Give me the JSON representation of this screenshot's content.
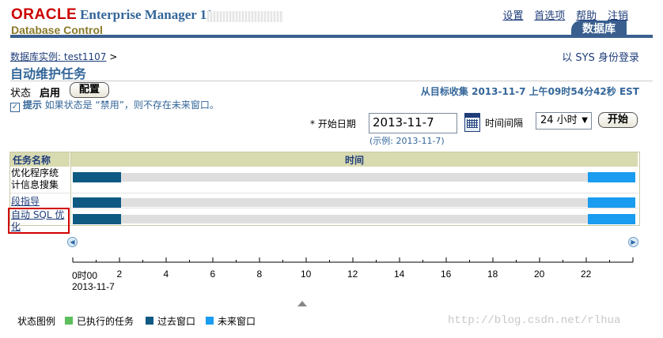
{
  "header": {
    "brand": "ORACLE",
    "product": "Enterprise Manager 11",
    "product_suffix": "g",
    "subtitle": "Database Control",
    "links": [
      "设置",
      "首选项",
      "帮助",
      "注销"
    ],
    "tab": "数据库"
  },
  "breadcrumb": {
    "link": "数据库实例: test1107",
    "separator": ">"
  },
  "login_info": "以 SYS 身份登录",
  "page_title": "自动维护任务",
  "status": {
    "label": "状态",
    "value": "启用",
    "configure_button": "配置"
  },
  "collected": "从目标收集 2013-11-7 上午09时54分42秒 EST",
  "tip": {
    "label": "提示",
    "text": "如果状态是 “禁用”，则不存在未来窗口。"
  },
  "controls": {
    "start_date_label": "* 开始日期",
    "start_date_value": "2013-11-7",
    "example": "(示例: 2013-11-7)",
    "interval_label": "时间间隔",
    "interval_value": "24 小时",
    "start_button": "开始"
  },
  "gantt": {
    "col_task": "任务名称",
    "col_time": "时间",
    "tasks": [
      {
        "name": "优化程序统计信息搜集",
        "line1": "优化程序统",
        "line2": "计信息搜集"
      },
      {
        "name": "段指导",
        "line1": "段指导",
        "line2": ""
      },
      {
        "name": "自动 SQL 优化",
        "line1": "自动 SQL 优",
        "line2": "化"
      }
    ],
    "axis_ticks": [
      "0时00",
      "2",
      "4",
      "6",
      "8",
      "10",
      "12",
      "14",
      "16",
      "18",
      "20",
      "22"
    ],
    "axis_date": "2013-11-7",
    "past_window_hours": [
      0,
      2
    ],
    "future_window_hours": [
      22,
      24
    ]
  },
  "legend": {
    "label": "状态图例",
    "items": [
      {
        "label": "已执行的任务",
        "color": "#5cbf5c"
      },
      {
        "label": "过去窗口",
        "color": "#0e5a82"
      },
      {
        "label": "未来窗口",
        "color": "#1a9cf0"
      }
    ]
  },
  "watermark": "http://blog.csdn.net/rlhua"
}
